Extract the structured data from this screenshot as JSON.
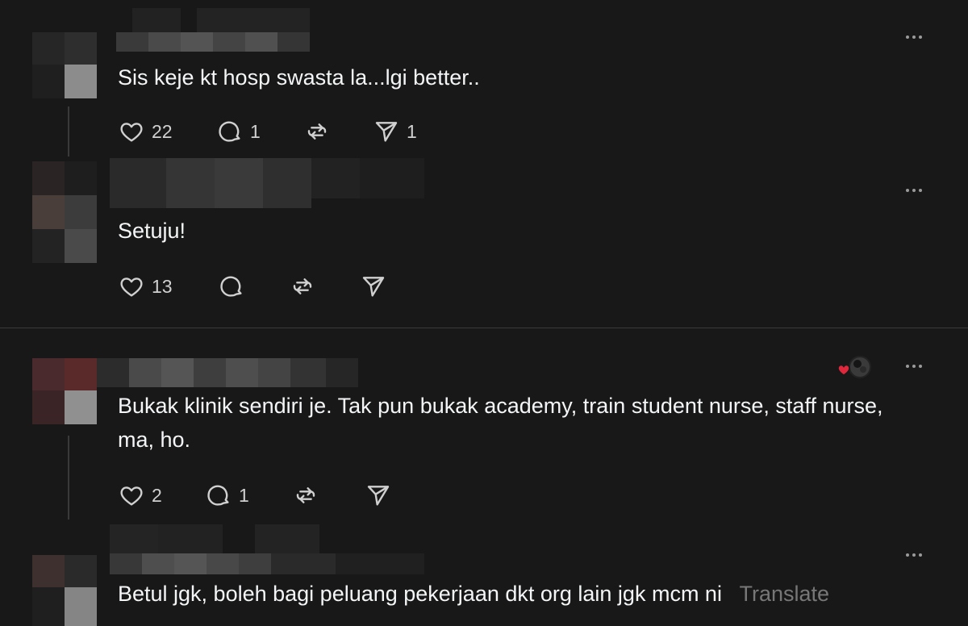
{
  "colors": {
    "background": "#181818",
    "text": "#f3f5f7",
    "muted": "#777777",
    "icon": "#d0d0d0",
    "heart_reaction": "#e0283c"
  },
  "comments": [
    {
      "text": "Sis keje kt hosp swasta la...lgi better..",
      "actions": {
        "likes": "22",
        "replies": "1",
        "reposts": "",
        "shares": "1"
      }
    },
    {
      "text": "Setuju!",
      "actions": {
        "likes": "13",
        "replies": "",
        "reposts": "",
        "shares": ""
      }
    },
    {
      "text": "Bukak klinik sendiri je. Tak pun bukak academy, train student nurse, staff nurse, ma, ho.",
      "actions": {
        "likes": "2",
        "replies": "1",
        "reposts": "",
        "shares": ""
      }
    },
    {
      "text": "Betul jgk, boleh bagi peluang pekerjaan dkt org lain jgk mcm ni",
      "translate_label": "Translate"
    }
  ],
  "icons": {
    "like": "heart-icon",
    "reply": "comment-icon",
    "repost": "repost-icon",
    "share": "send-icon",
    "more": "more-options-icon",
    "reaction": "author-liked-icon"
  }
}
